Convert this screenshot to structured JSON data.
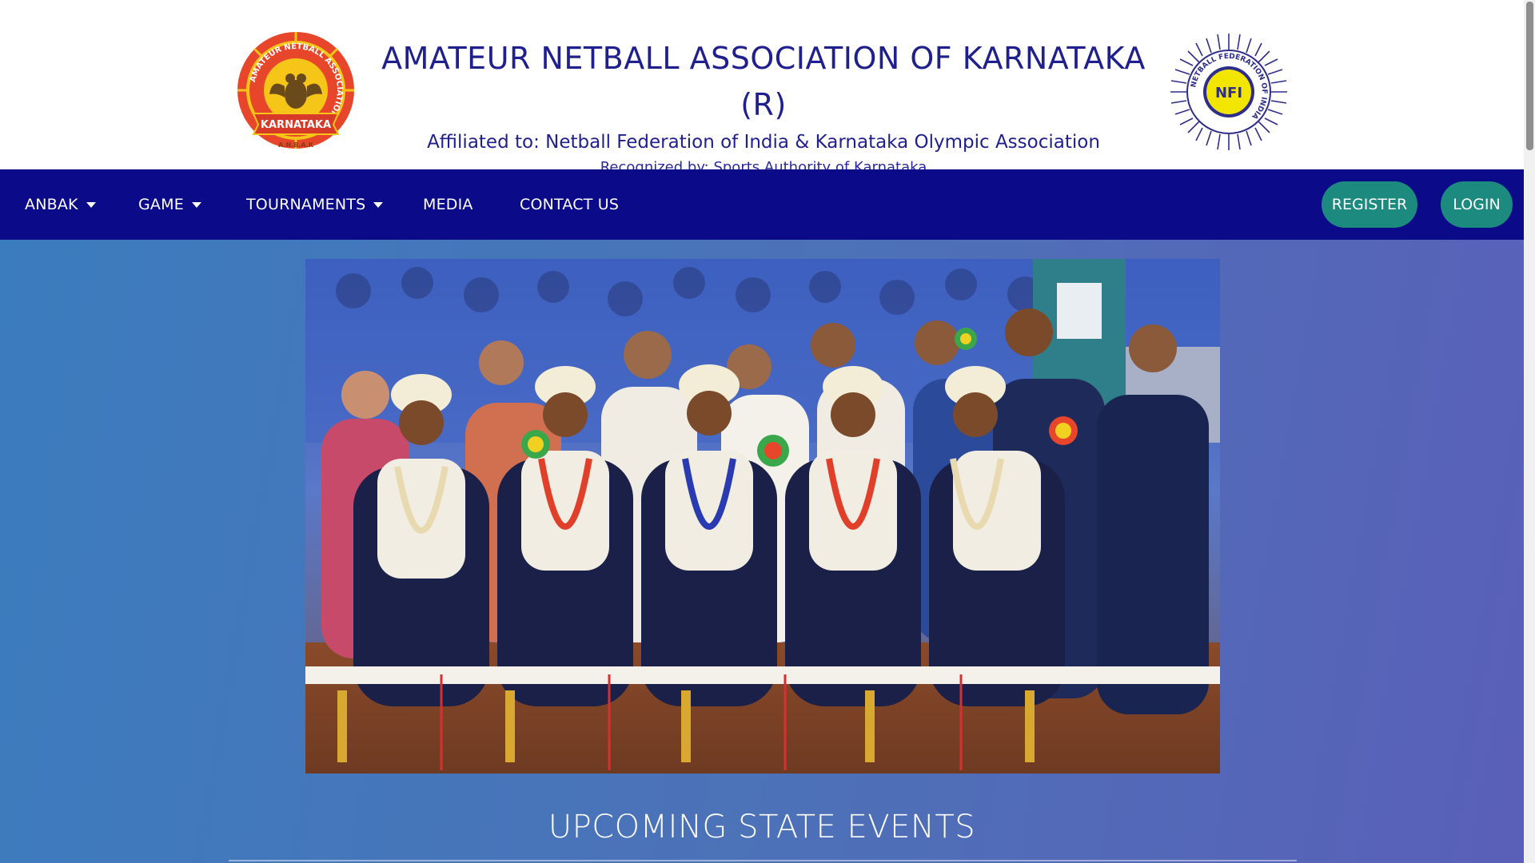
{
  "header": {
    "title": "AMATEUR NETBALL ASSOCIATION OF KARNATAKA (R)",
    "affiliation": "Affiliated to: Netball Federation of India & Karnataka Olympic Association",
    "recognition": "Recognized by: Sports Authority of Karnataka",
    "logo_left": {
      "icon": "anbak-emblem-icon",
      "ring_text": "AMATEUR NETBALL ASSOCIATION OF",
      "banner_text": "KARNATAKA",
      "bottom_text": "A.N.B.A.K",
      "colors": {
        "outer": "#e8462a",
        "ring": "#f5c518",
        "banner": "#d83a2a"
      }
    },
    "logo_right": {
      "icon": "netball-federation-india-icon",
      "ring_text": "NETBALL FEDERATION OF INDIA",
      "center_text": "NFI",
      "colors": {
        "ink": "#2e2e8a",
        "center": "#f2e600"
      }
    }
  },
  "nav": {
    "items": [
      {
        "label": "ANBAK",
        "dropdown": true
      },
      {
        "label": "GAME",
        "dropdown": true
      },
      {
        "label": "TOURNAMENTS",
        "dropdown": true
      },
      {
        "label": "MEDIA",
        "dropdown": false
      },
      {
        "label": "CONTACT US",
        "dropdown": false
      }
    ],
    "register_label": "REGISTER",
    "login_label": "LOGIN",
    "colors": {
      "bar": "#0b0b8a",
      "pill": "#1c8a7e",
      "text": "#ffffff"
    }
  },
  "hero": {
    "description_icon": "award-ceremony-photo"
  },
  "section": {
    "title": "UPCOMING STATE EVENTS"
  },
  "colors": {
    "page_gradient_start": "#3a7dbe",
    "page_gradient_end": "#5a5fb8",
    "title_text": "#1f1f8e"
  }
}
